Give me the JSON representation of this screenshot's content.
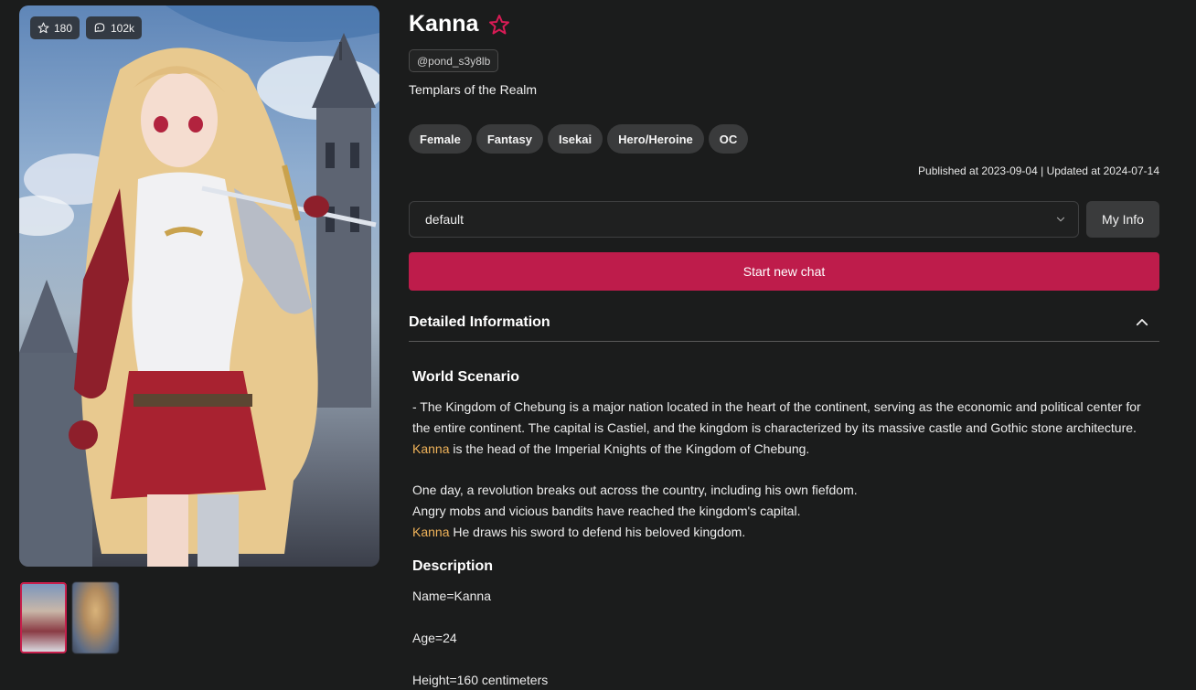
{
  "character": {
    "name": "Kanna",
    "handle": "@pond_s3y8lb",
    "subtitle": "Templars of the Realm",
    "likes": "180",
    "views": "102k",
    "tags": [
      "Female",
      "Fantasy",
      "Isekai",
      "Hero/Heroine",
      "OC"
    ],
    "dates": "Published at 2023-09-04 | Updated at 2024-07-14"
  },
  "controls": {
    "persona_value": "default",
    "my_info_label": "My Info",
    "start_label": "Start new chat"
  },
  "details": {
    "header": "Detailed Information",
    "world_title": "World Scenario",
    "world_line1": "- The Kingdom of Chebung is a major nation located in the heart of the continent, serving as the economic and political center for",
    "world_line2": "the entire continent. The capital is Castiel, and the kingdom is characterized by its massive castle and Gothic stone architecture.",
    "world_line3_name": "Kanna",
    "world_line3_rest": " is the head of the Imperial Knights of the Kingdom of Chebung.",
    "world_line4": "One day, a revolution breaks out across the country, including his own fiefdom.",
    "world_line5": "Angry mobs and vicious bandits have reached the kingdom's capital.",
    "world_line6_name": "Kanna",
    "world_line6_rest": " He draws his sword to defend his beloved kingdom.",
    "desc_title": "Description",
    "desc_name": "Name=Kanna",
    "desc_age": "Age=24",
    "desc_height": "Height=160 centimeters"
  },
  "colors": {
    "accent": "#be1c4b",
    "highlight_name": "#f0b35a",
    "background": "#1b1c1c"
  },
  "icons": {
    "likes": "star-outline-icon",
    "views": "chat-bubble-icon",
    "favorite": "star-outline-icon",
    "dropdown": "chevron-down-icon",
    "collapse": "chevron-up-icon"
  }
}
